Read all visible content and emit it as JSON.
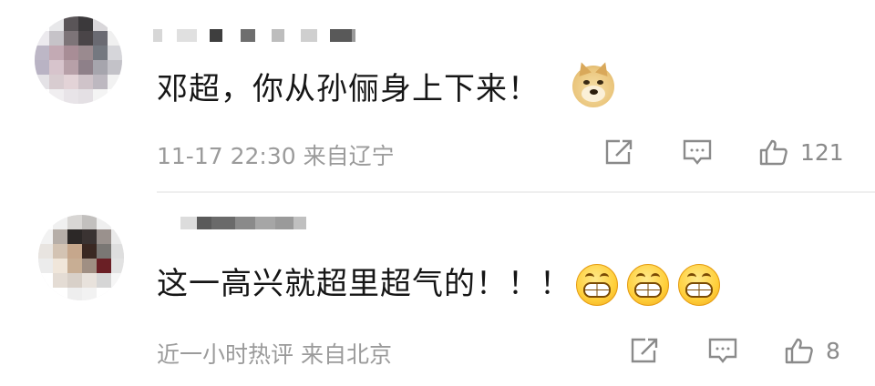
{
  "comments": [
    {
      "text": "邓超，你从孙俪身上下来！",
      "emojis": [
        "doge-emoji"
      ],
      "meta": "11-17 22:30  来自辽宁",
      "like_count": "121"
    },
    {
      "text": "这一高兴就超里超气的！！！",
      "emojis": [
        "grin-emoji",
        "grin-emoji",
        "grin-emoji"
      ],
      "meta": "近一小时热评  来自北京",
      "like_count": "8"
    }
  ],
  "colors": {
    "text": "#161616",
    "meta": "#9b9b9b",
    "icon": "#8a8a8a",
    "divider": "#efefef"
  }
}
